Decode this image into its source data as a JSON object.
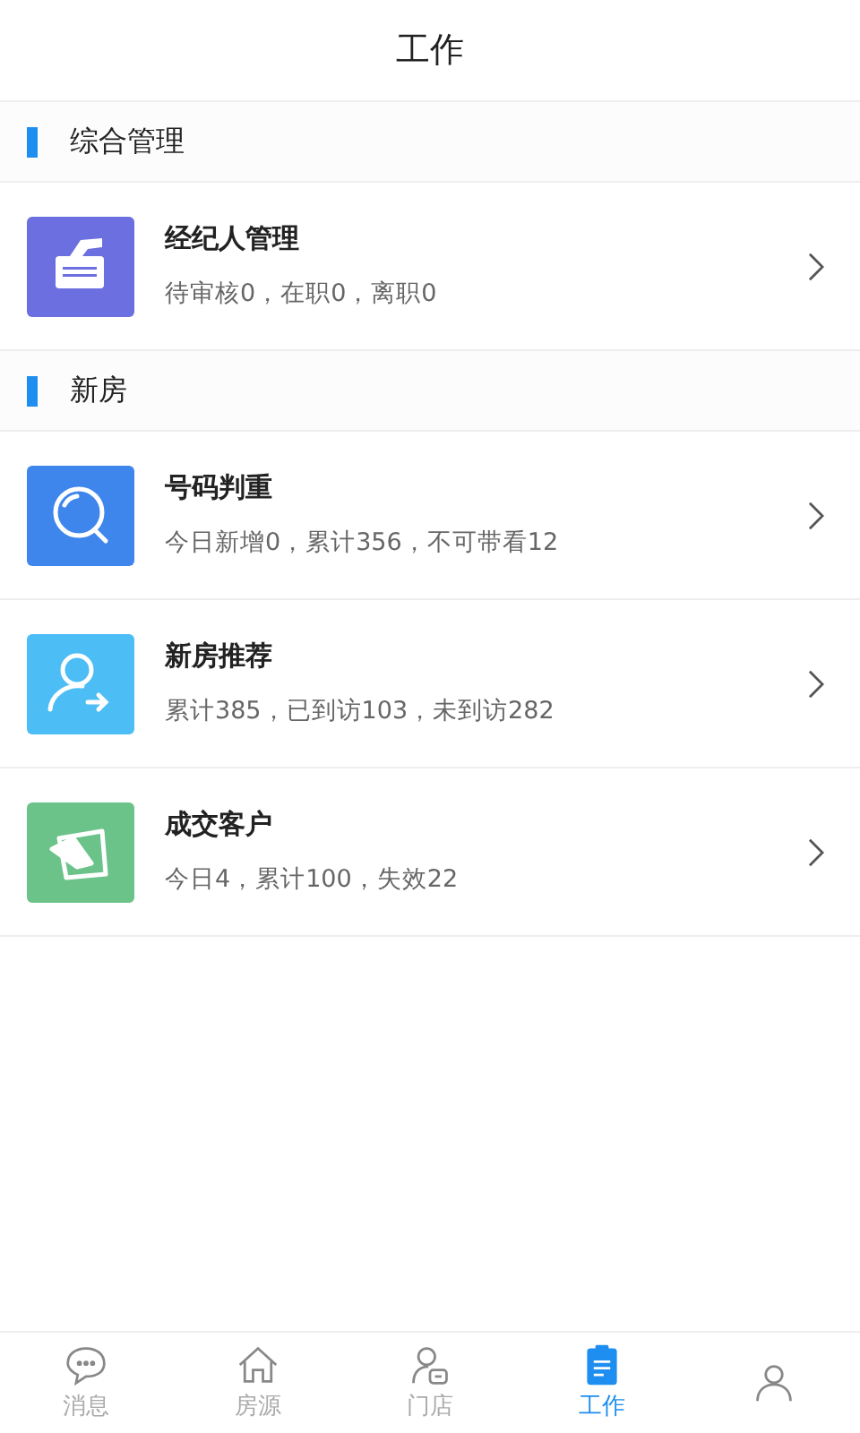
{
  "header": {
    "title": "工作"
  },
  "sections": [
    {
      "title": "综合管理",
      "items": [
        {
          "kind": "agent",
          "title": "经纪人管理",
          "summary": "待审核0，在职0，离职0",
          "color": "#6b6fe0"
        }
      ]
    },
    {
      "title": "新房",
      "items": [
        {
          "kind": "search",
          "title": "号码判重",
          "summary": "今日新增0，累计356，不可带看12",
          "color": "#3f86ec"
        },
        {
          "kind": "recommend",
          "title": "新房推荐",
          "summary": "累计385，已到访103，未到访282",
          "color": "#4dbdf5"
        },
        {
          "kind": "deal",
          "title": "成交客户",
          "summary": "今日4，累计100，失效22",
          "color": "#6cc38a"
        }
      ]
    }
  ],
  "tabs": [
    {
      "kind": "message",
      "label": "消息",
      "selected": false
    },
    {
      "kind": "house",
      "label": "房源",
      "selected": false
    },
    {
      "kind": "store",
      "label": "门店",
      "selected": false
    },
    {
      "kind": "work",
      "label": "工作",
      "selected": true
    },
    {
      "kind": "profile",
      "selected": false
    }
  ]
}
